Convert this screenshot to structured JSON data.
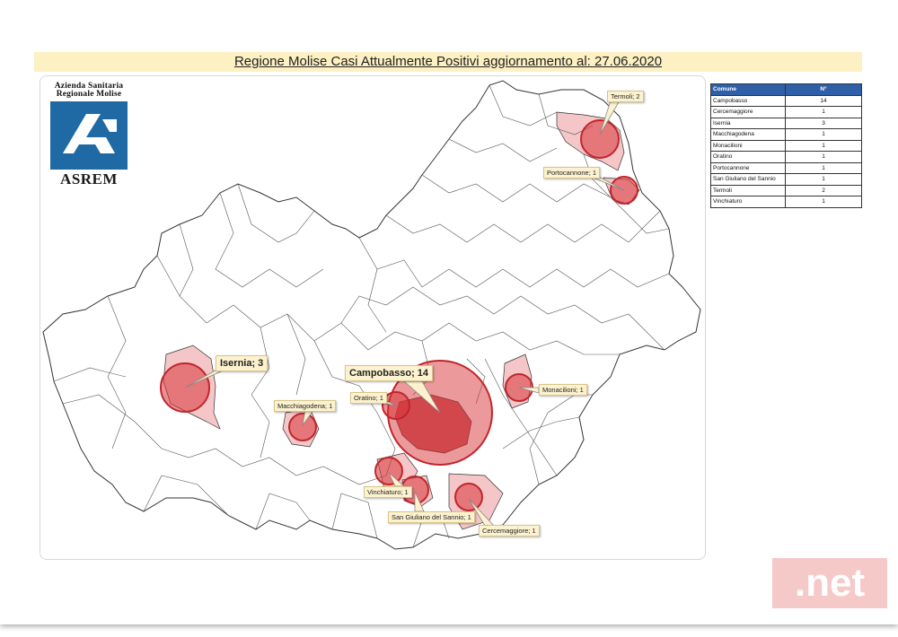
{
  "title": "Regione Molise Casi Attualmente Positivi aggiornamento al: 27.06.2020",
  "logo": {
    "line1": "Azienda Sanitaria",
    "line2": "Regionale Molise",
    "acronym": "ASREM"
  },
  "table": {
    "header_comune": "Comune",
    "header_n": "N°",
    "rows": [
      {
        "comune": "Campobasso",
        "n": "14"
      },
      {
        "comune": "Cercemaggiore",
        "n": "1"
      },
      {
        "comune": "Isernia",
        "n": "3"
      },
      {
        "comune": "Macchiagodena",
        "n": "1"
      },
      {
        "comune": "Monacilioni",
        "n": "1"
      },
      {
        "comune": "Oratino",
        "n": "1"
      },
      {
        "comune": "Portocannone",
        "n": "1"
      },
      {
        "comune": "San Giuliano del Sannio",
        "n": "1"
      },
      {
        "comune": "Termoli",
        "n": "2"
      },
      {
        "comune": "Vinchiaturo",
        "n": "1"
      }
    ]
  },
  "callouts": {
    "termoli": "Termoli; 2",
    "portocannone": "Portocannone; 1",
    "isernia": "Isernia; 3",
    "campobasso": "Campobasso; 14",
    "oratino": "Oratino; 1",
    "macchiagodena": "Macchiagodena; 1",
    "monacilioni": "Monacilioni; 1",
    "vinchiaturo": "Vinchiaturo; 1",
    "san_giuliano": "San Giuliano del Sannio; 1",
    "cercemaggiore": "Cercemaggiore; 1"
  },
  "colors": {
    "bubble": "#d9343a",
    "highlight_area": "#f4c6c8",
    "table_header": "#2f5fa8",
    "title_band": "#fdf0c2"
  },
  "watermark": ".net"
}
